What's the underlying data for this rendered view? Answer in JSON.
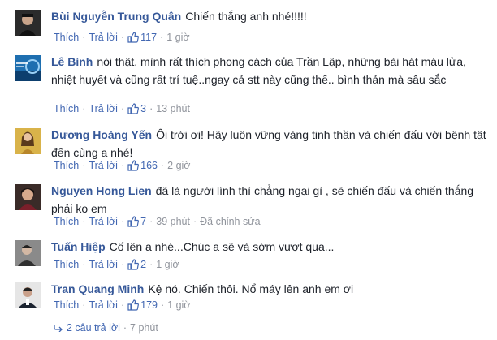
{
  "actions": {
    "like_label": "Thích",
    "reply_label": "Trả lời"
  },
  "comments": [
    {
      "author": "Bùi Nguyễn Trung Quân",
      "text": "Chiến thắng anh nhé!!!!!",
      "likes": "117",
      "time": "1 giờ",
      "edited": ""
    },
    {
      "author": "Lê Bình",
      "text": "nói thật, mình rất thích phong cách của Trần Lập, những bài hát máu lửa, nhiệt huyết và cũng rất trí tuệ..ngay cả stt này cũng thế.. bình thản mà sâu sắc",
      "likes": "3",
      "time": "13 phút",
      "edited": ""
    },
    {
      "author": "Dương Hoàng Yến",
      "text": "Ôi trời ơi! Hãy luôn vững vàng tinh thần và chiến đấu với bệnh tật đến cùng a nhé!",
      "likes": "166",
      "time": "2 giờ",
      "edited": ""
    },
    {
      "author": "Nguyen Hong Lien",
      "text": "đã là người lính thì chẳng ngại gì , sẽ chiến đấu và chiến thắng phải ko em",
      "likes": "7",
      "time": "39 phút",
      "edited": "Đã chỉnh sửa"
    },
    {
      "author": "Tuấn Hiệp",
      "text": "Cố lên a nhé...Chúc a sẽ và sớm vượt qua...",
      "likes": "2",
      "time": "1 giờ",
      "edited": ""
    },
    {
      "author": "Tran Quang Minh",
      "text": "Kệ nó. Chiến thôi. Nổ máy lên anh em ơi",
      "likes": "179",
      "time": "1 giờ",
      "edited": ""
    }
  ],
  "replies": {
    "label": "2 câu trả lời",
    "time": "7 phút"
  },
  "colors": {
    "link": "#365899",
    "action": "#4267b2",
    "meta": "#90949c",
    "text": "#1d2129"
  },
  "icons": {
    "like": "thumbs-up-icon",
    "reply": "reply-arrow-icon"
  }
}
